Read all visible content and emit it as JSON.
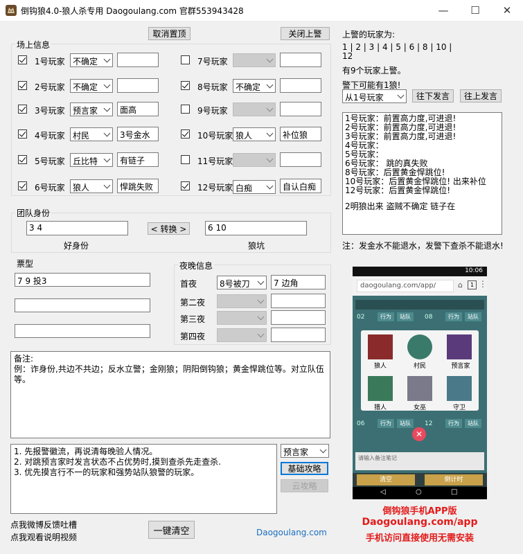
{
  "window": {
    "title": "倒钩狼4.0-狼人杀专用 Daogoulang.com 官群553943428",
    "minimize": "—",
    "maximize": "☐",
    "close": "✕"
  },
  "top": {
    "cancel_pin": "取消置顶",
    "close_sheriff": "关闭上警"
  },
  "field_group_title": "场上信息",
  "players": [
    {
      "label": "1号玩家",
      "checked": true,
      "role": "不确定",
      "note": ""
    },
    {
      "label": "2号玩家",
      "checked": true,
      "role": "不确定",
      "note": ""
    },
    {
      "label": "3号玩家",
      "checked": true,
      "role": "预言家",
      "note": "面高"
    },
    {
      "label": "4号玩家",
      "checked": true,
      "role": "村民",
      "note": "3号金水"
    },
    {
      "label": "5号玩家",
      "checked": true,
      "role": "丘比特",
      "note": "有链子"
    },
    {
      "label": "6号玩家",
      "checked": true,
      "role": "狼人",
      "note": "悍跳失败"
    },
    {
      "label": "7号玩家",
      "checked": false,
      "role": "",
      "note": ""
    },
    {
      "label": "8号玩家",
      "checked": true,
      "role": "不确定",
      "note": ""
    },
    {
      "label": "9号玩家",
      "checked": false,
      "role": "",
      "note": ""
    },
    {
      "label": "10号玩家",
      "checked": true,
      "role": "狼人",
      "note": "补位狼"
    },
    {
      "label": "11号玩家",
      "checked": false,
      "role": "",
      "note": ""
    },
    {
      "label": "12号玩家",
      "checked": true,
      "role": "白痴",
      "note": "自认白痴"
    }
  ],
  "team": {
    "title": "团队身份",
    "good_value": "3 4",
    "good_label": "好身份",
    "swap_label": "< 转换 >",
    "wolf_value": "6 10",
    "wolf_label": "狼坑"
  },
  "votes": {
    "title": "票型",
    "lines": [
      "7 9 投3",
      "",
      ""
    ]
  },
  "night": {
    "title": "夜晚信息",
    "rows": [
      {
        "label": "首夜",
        "select": "8号被刀",
        "note": "7 边角"
      },
      {
        "label": "第二夜",
        "select": "",
        "note": ""
      },
      {
        "label": "第三夜",
        "select": "",
        "note": ""
      },
      {
        "label": "第四夜",
        "select": "",
        "note": ""
      }
    ]
  },
  "remarks": {
    "line1": "备注:",
    "line2": "例：诈身份,共边不共边；反水立警；金刚狼；阴阳倒钩狼；黄金悍跳位等。对立队伍等。"
  },
  "tips": {
    "lines": [
      "1. 先报警徽流，再说清每晚验人情况。",
      "2. 对跳预言家时发言状态不占优势时,摸到查杀先走查杀.",
      "3.  优先摸言行不一的玩家和强势站队狼警的玩家。"
    ],
    "role_select": "预言家",
    "basic_strategy": "基础攻略",
    "cloud_strategy": "云攻略"
  },
  "bottom": {
    "weibo_link": "点我微博反馈吐槽",
    "video_link": "点我观看说明视频",
    "clear_button": "一键清空",
    "site": "Daogoulang.com"
  },
  "sheriff": {
    "title": "上警的玩家为:",
    "players": [
      "1",
      "2",
      "3",
      "4",
      "5",
      "6",
      "8",
      "10",
      "12"
    ],
    "count_text": "有9个玩家上警。",
    "possible_text": "警下可能有1狼!",
    "from_select": "从1号玩家",
    "speak_down": "往下发言",
    "speak_up": "往上发言"
  },
  "log": {
    "lines": [
      "1号玩家：前置高力度,可进退!",
      "2号玩家：前置高力度,可进退!",
      "3号玩家：前置高力度,可进退!",
      "4号玩家：",
      "5号玩家：",
      "6号玩家：  跳的真失败",
      "8号玩家：后置黄金悍跳位!",
      "10号玩家：后置黄金悍跳位!      出来补位",
      "12号玩家：后置黄金悍跳位!",
      "",
      "2明狼出来   盗贼不确定 链子在"
    ],
    "note": "注：发金水不能退水，发警下查杀不能退水!"
  },
  "phone": {
    "time": "10:06",
    "url": "daogoulang.com/app/",
    "roles": [
      "狼人",
      "村民",
      "预言家",
      "猎人",
      "女巫",
      "守卫"
    ],
    "row_nums_top": [
      "02",
      "08"
    ],
    "row_nums_bottom": [
      "06",
      "12"
    ],
    "action_a": "行为",
    "action_b": "站队",
    "input_placeholder": "请输入备注笔记",
    "clear": "清空",
    "stats": "倒计时"
  },
  "promo": {
    "line1": "倒钩狼手机APP版",
    "line2": "Daogoulang.com/app",
    "line3": "手机访问直接使用无需安装"
  },
  "colors": {
    "promo_red": "#e31b1b",
    "site_blue": "#1a6ec0",
    "phone_dark": "#2a3a3a",
    "phone_teal": "#3c6f73",
    "phone_gold": "#c8a14a"
  }
}
